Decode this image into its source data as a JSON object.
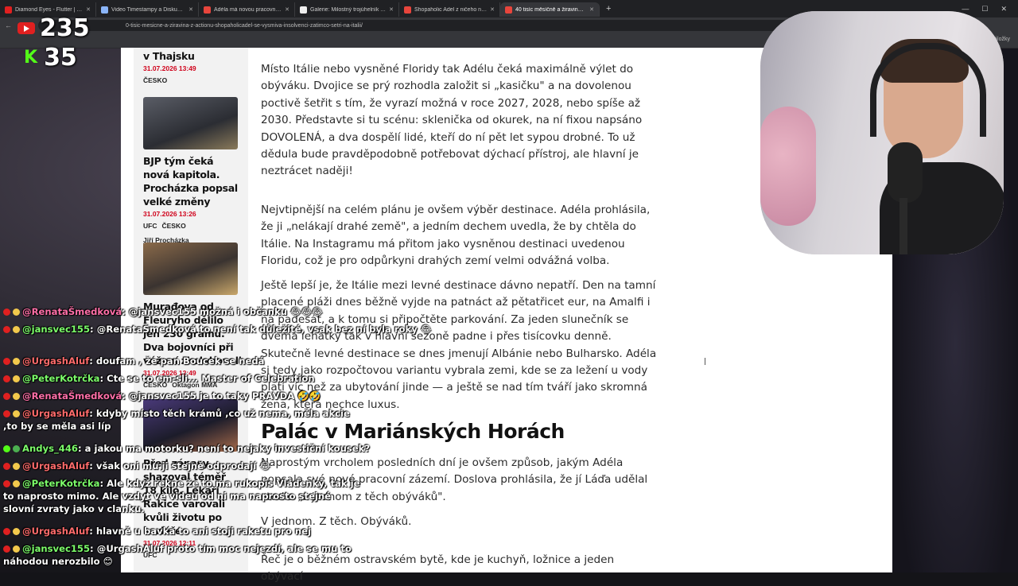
{
  "browser": {
    "tabs": [
      {
        "title": "Diamond Eyes - Flutter | Futura",
        "color": "#e02020",
        "active": false
      },
      {
        "title": "Video Timestampy a Diskuze - G",
        "color": "#8ab4f8",
        "active": false
      },
      {
        "title": "Adéla má novou pracovnu? A u",
        "color": "#e8453c",
        "active": false
      },
      {
        "title": "Galerie: Milostný trojúhelník Ad",
        "color": "#eeeeee",
        "active": false
      },
      {
        "title": "Shopaholic Adel z ničeho nic vy",
        "color": "#e8453c",
        "active": false
      },
      {
        "title": "40 tisíc měsíčně a žiravina z Ac",
        "color": "#e8453c",
        "active": true
      }
    ],
    "new_tab": "+",
    "url": "0-tisic-mesicne-a-ziravina-z-actionu-shopaholicadel-se-vysmiva-insolvenci-zatimco-setri-na-italii/",
    "bookmarks_right": "Všechny záložky"
  },
  "counters": {
    "youtube": "235",
    "kick": "35",
    "kick_logo": "K"
  },
  "sidebar": {
    "items": [
      {
        "title": "v Thajsku",
        "date": "31.07.2026 13:49",
        "tags": [
          "ČESKO"
        ],
        "author": ""
      },
      {
        "title": "BJP tým čeká nová kapitola. Procházka popsal velké změny",
        "date": "31.07.2026 13:26",
        "tags": [
          "UFC",
          "ČESKO"
        ],
        "author": "Jiří Procházka"
      },
      {
        "title": "Murađova od Fleuryho dělilo jen 230 gramů. Dva bojovníci při vážení zkolabovali",
        "date": "31.07.2026 12:49",
        "tags": [
          "ČESKO",
          "Oktagon MMA"
        ],
        "author": ""
      },
      {
        "title": "Před zápasy shazoval téměř 18 kilo. Lékaři Rakice varovali kvůli životu po kariéře",
        "date": "31.07.2026 12:11",
        "tags": [
          "UFC"
        ],
        "author": ""
      }
    ]
  },
  "article": {
    "p1": "Místo Itálie nebo vysněné Floridy tak Adélu čeká maximálně výlet do obýváku. Dvojice se prý rozhodla založit si „kasičku\" a na dovolenou poctivě šetřit s tím, že vyrazí možná v roce 2027, 2028, nebo spíše až 2030. Představte si tu scénu: sklenička od okurek, na ní fixou napsáno DOVOLENÁ, a dva dospělí lidé, kteří do ní pět let sypou drobné. To už dědula bude pravděpodobně potřebovat dýchací přístroj, ale hlavní je neztrácet naději!",
    "p2": "Nejvtipnější na celém plánu je ovšem výběr destinace. Adéla prohlásila, že ji „nelákají drahé země\", a jedním dechem uvedla, že by chtěla do Itálie. Na Instagramu má přitom jako vysněnou destinaci uvedenou Floridu, což je pro odpůrkyni drahých zemí velmi odvážná volba.",
    "p3": "Ještě lepší je, že Itálie mezi levné destinace dávno nepatří. Den na tamní placené pláži dnes běžně vyjde na patnáct až pětatřicet eur, na Amalfi i na padesát, a k tomu si připočtěte parkování. Za jeden slunečník se dvěma lehátky tak v hlavní sezoně padne i přes tisícovku denně. Skutečně levné destinace se dnes jmenují Albánie nebo Bulharsko. Adéla si tedy jako rozpočtovou variantu vybrala zemi, kde se za ležení u vody platí víc než za ubytování jinde — a ještě se nad tím tváří jako skromná žena, která nechce luxus.",
    "h2": "Palác v Mariánských Horách",
    "p4": "Naprostým vrcholem posledních dní je ovšem způsob, jakým Adéla popsala své nové pracovní zázemí. Doslova prohlásila, že jí Láďa udělal studio „v jednom z těch obýváků\".",
    "p5": "V jednom. Z těch. Obýváků.",
    "p6": "Řeč je o běžném ostravském bytě, kde je kuchyň, ložnice a jeden obývací"
  },
  "chat": [
    {
      "user": "@RenataŠmedková",
      "color": "#ff6fa8",
      "text": ": @jansvec155 možná i občanku 😂😂😂"
    },
    {
      "user": "@jansvec155",
      "color": "#7cfc6a",
      "text": ": @RenataŠmedková to není tak důležité, vsak bez ní byla roky 😂"
    },
    {
      "user": "@UrgashAluf",
      "color": "#ff6b6b",
      "text": ": doufam , že pan Boucek se nedá"
    },
    {
      "user": "@PeterKotrčka",
      "color": "#7cfc6a",
      "text": ": Cte se to em-sli... Master of Celebration"
    },
    {
      "user": "@RenataŠmedková",
      "color": "#ff6fa8",
      "text": ": @jansvec155 je to taky PRAVDA 🤣🤣"
    },
    {
      "user": "@UrgashAluf",
      "color": "#ff6b6b",
      "text": ": kdyby místo těch krámů ,co už nema, měla akcie ,to by se měla asi líp"
    },
    {
      "user": "Andys_446",
      "color": "#7cfc6a",
      "text": ": a jakou ma motorku? není to nejaky investiční kousek?"
    },
    {
      "user": "@UrgashAluf",
      "color": "#ff6b6b",
      "text": ": však oni mu ji stejně odprodají 😂"
    },
    {
      "user": "@PeterKotrčka",
      "color": "#7cfc6a",
      "text": ": Ale když rekne že to ma rukopis Vladenky, tak je to naprosto mimo. Ale vzdyt ve videu od ni ma naprosto stejné slovní zvraty jako v clanku."
    },
    {
      "user": "@UrgashAluf",
      "color": "#ff6b6b",
      "text": ": hlavně u bavka to ani stoji raketu pro nej"
    },
    {
      "user": "@jansvec155",
      "color": "#7cfc6a",
      "text": ": @UrgashAluf proto tím moc nejezdí, ale se mu to náhodou nerozbilo 😊"
    }
  ]
}
